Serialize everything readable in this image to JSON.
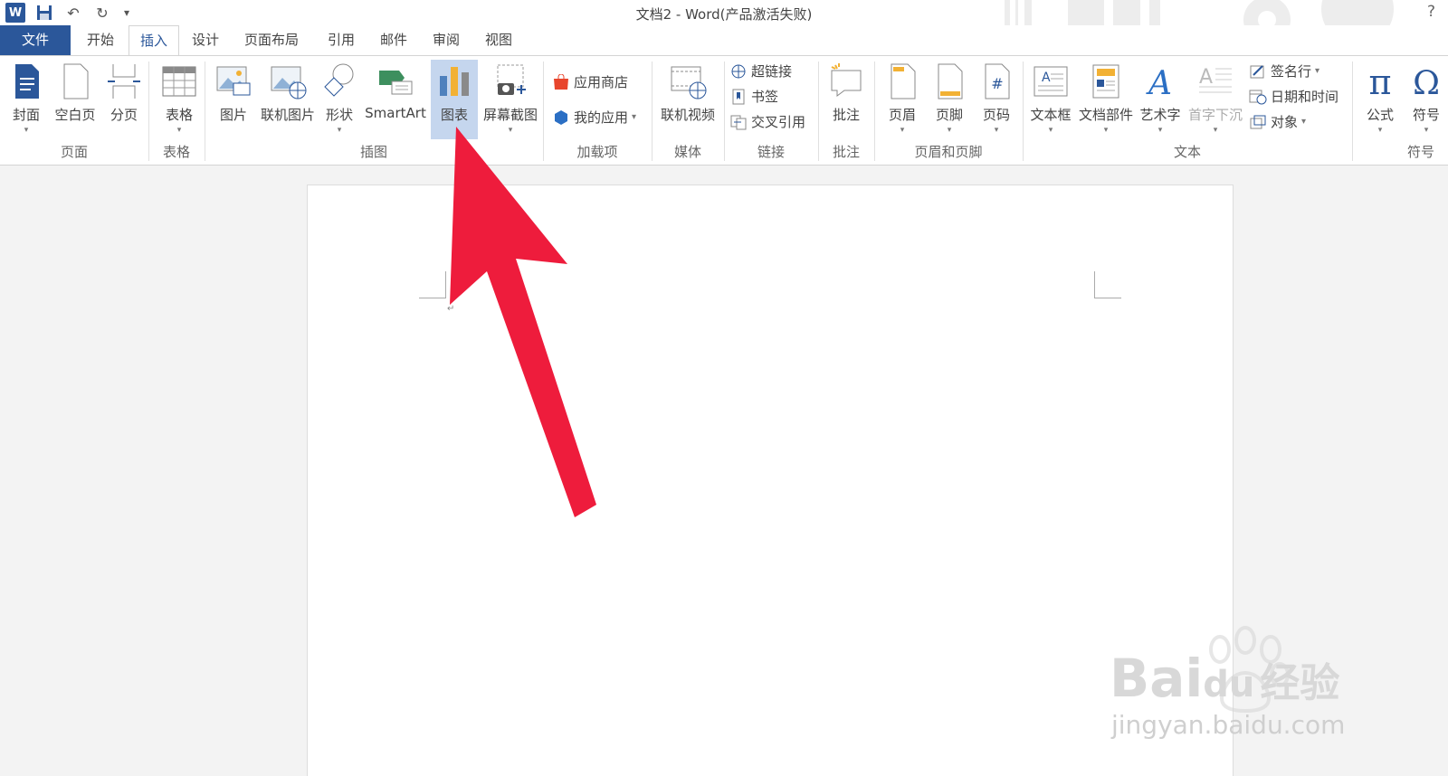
{
  "window": {
    "title": "文档2 - Word(产品激活失败)",
    "help": "?"
  },
  "qat": {
    "word_logo": "W",
    "undo": "↶",
    "redo": "↻",
    "more": "▾"
  },
  "tabs": [
    {
      "label": "文件"
    },
    {
      "label": "开始"
    },
    {
      "label": "插入"
    },
    {
      "label": "设计"
    },
    {
      "label": "页面布局"
    },
    {
      "label": "引用"
    },
    {
      "label": "邮件"
    },
    {
      "label": "审阅"
    },
    {
      "label": "视图"
    }
  ],
  "ribbon": {
    "cover": "封面",
    "blank_page": "空白页",
    "page_break": "分页",
    "table": "表格",
    "picture": "图片",
    "online_picture": "联机图片",
    "shapes": "形状",
    "smartart": "SmartArt",
    "chart": "图表",
    "screenshot": "屏幕截图",
    "app_store": "应用商店",
    "my_apps": "我的应用",
    "online_video": "联机视频",
    "hyperlink": "超链接",
    "bookmark": "书签",
    "cross_ref": "交叉引用",
    "comment": "批注",
    "header": "页眉",
    "footer": "页脚",
    "page_number": "页码",
    "text_box": "文本框",
    "quick_parts": "文档部件",
    "wordart": "艺术字",
    "drop_cap": "首字下沉",
    "signature": "签名行",
    "date_time": "日期和时间",
    "object": "对象",
    "equation": "公式",
    "symbol": "符号",
    "dropdown": "▾"
  },
  "groups": {
    "pages": "页面",
    "tables": "表格",
    "illustrations": "插图",
    "addins": "加载项",
    "media": "媒体",
    "links": "链接",
    "comments": "批注",
    "header_footer": "页眉和页脚",
    "text": "文本",
    "symbols": "符号"
  },
  "document": {
    "paragraph_mark": "↵"
  },
  "watermark": {
    "brand": "Bai",
    "brand2": "du",
    "cn": "经验",
    "url": "jingyan.baidu.com"
  },
  "colors": {
    "accent": "#2b579a",
    "arrow": "#ee1c3c",
    "highlight": "#c5d6ee"
  }
}
